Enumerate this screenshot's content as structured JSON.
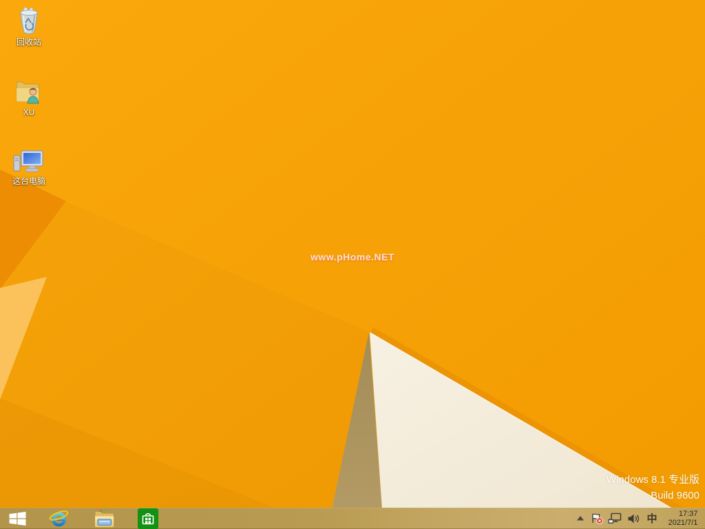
{
  "desktop": {
    "watermark": "www.pHome.NET",
    "icons": [
      {
        "id": "recycle-bin",
        "label": "回收站"
      },
      {
        "id": "user-folder",
        "label": "XU"
      },
      {
        "id": "this-pc",
        "label": "这台电脑"
      }
    ],
    "version": {
      "line1": "Windows 8.1 专业版",
      "line2": "Build 9600"
    }
  },
  "taskbar": {
    "apps": [
      {
        "name": "start-button"
      },
      {
        "name": "internet-explorer"
      },
      {
        "name": "file-explorer"
      },
      {
        "name": "store"
      }
    ],
    "tray": {
      "icons": [
        "hidden-icons-chevron",
        "action-center-flag",
        "network",
        "volume"
      ],
      "ime": "中",
      "time": "17:37",
      "date": "2021/7/1"
    }
  },
  "colors": {
    "wallpaper_orange": "#F8A307",
    "wallpaper_orange_dark": "#ED8D04",
    "wallpaper_pale": "#FCC566",
    "wallpaper_cream": "#F3ECDC",
    "wallpaper_olive": "#AC945E",
    "edge_stripe": "#EC9404",
    "taskbar_tan": "#BC9E55",
    "store_green": "#129112"
  }
}
